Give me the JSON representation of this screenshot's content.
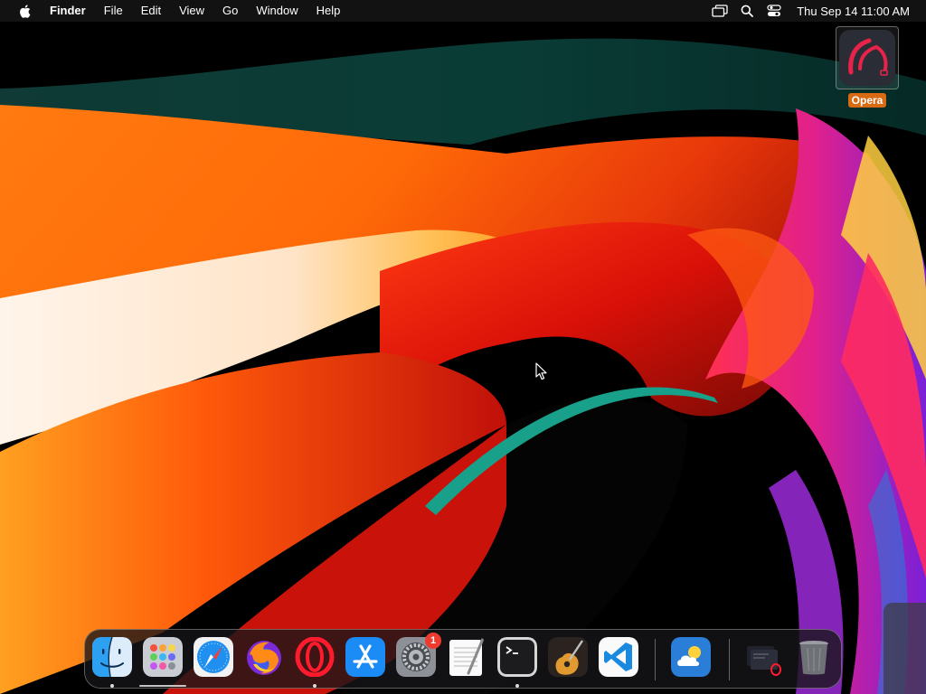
{
  "menubar": {
    "app_name": "Finder",
    "items": [
      "File",
      "Edit",
      "View",
      "Go",
      "Window",
      "Help"
    ],
    "clock": "Thu Sep 14  11:00 AM",
    "status_icons": [
      "screen-mirroring-icon",
      "spotlight-search-icon",
      "control-center-icon"
    ]
  },
  "desktop": {
    "icons": [
      {
        "label": "Opera",
        "icon": "opera-icon",
        "selected": true
      }
    ]
  },
  "dock": {
    "apps": [
      {
        "name": "Finder",
        "icon": "finder-icon",
        "running": true
      },
      {
        "name": "Launchpad",
        "icon": "launchpad-icon",
        "running": false
      },
      {
        "name": "Safari",
        "icon": "safari-icon",
        "running": false
      },
      {
        "name": "Firefox",
        "icon": "firefox-icon",
        "running": false
      },
      {
        "name": "Opera",
        "icon": "opera-icon",
        "running": true
      },
      {
        "name": "App Store",
        "icon": "app-store-icon",
        "running": false
      },
      {
        "name": "System Settings",
        "icon": "system-settings-icon",
        "running": false,
        "badge": "1"
      },
      {
        "name": "TextEdit",
        "icon": "textedit-icon",
        "running": false
      },
      {
        "name": "Terminal",
        "icon": "terminal-icon",
        "running": true
      },
      {
        "name": "GarageBand",
        "icon": "garageband-icon",
        "running": false
      },
      {
        "name": "Visual Studio Code",
        "icon": "vscode-icon",
        "running": false
      },
      {
        "name": "Weather",
        "icon": "weather-icon",
        "running": false
      },
      {
        "name": "Downloads",
        "icon": "downloads-stack-icon",
        "running": false
      },
      {
        "name": "Trash",
        "icon": "trash-icon",
        "running": false
      }
    ]
  },
  "colors": {
    "menubar_bg": "#141414",
    "desktop_label_bg": "#d86a12",
    "badge_red": "#ee3b30"
  }
}
